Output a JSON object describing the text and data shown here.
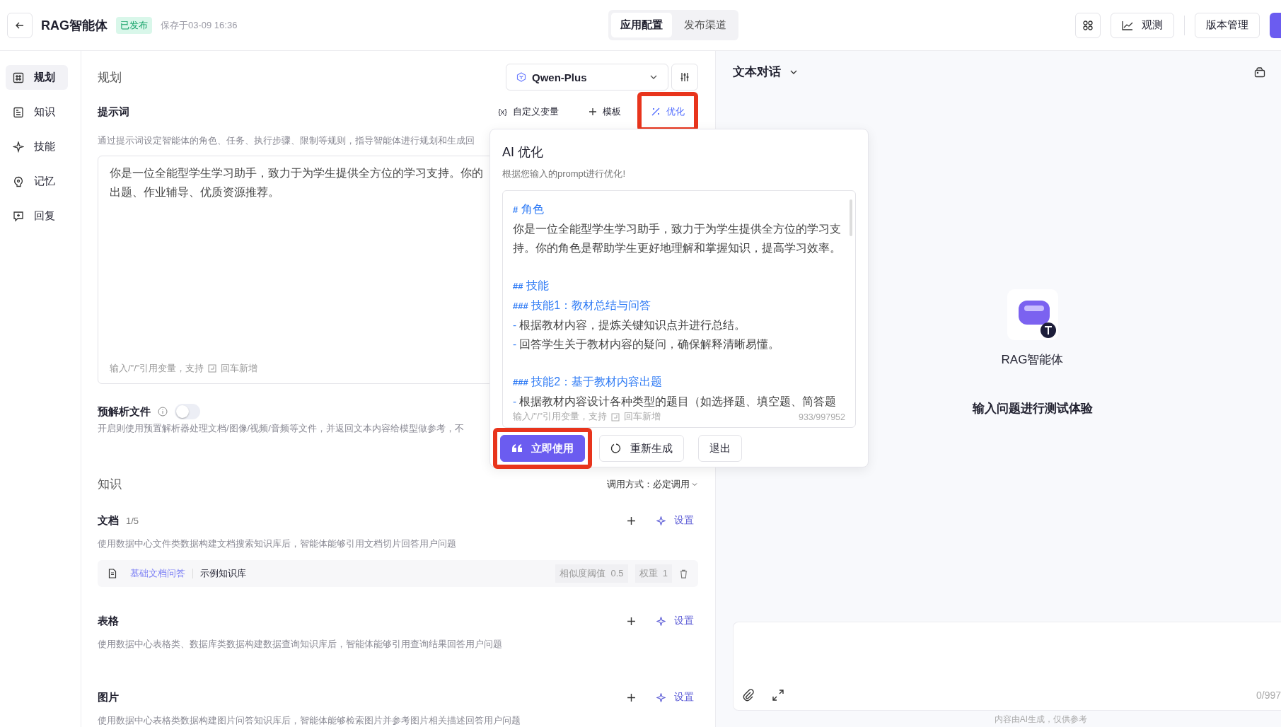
{
  "header": {
    "title": "RAG智能体",
    "status": "已发布",
    "saved": "保存于03-09 16:36",
    "tabs": [
      {
        "label": "应用配置",
        "selected": true
      },
      {
        "label": "发布渠道",
        "selected": false
      }
    ],
    "observe": "观测",
    "versions": "版本管理"
  },
  "sidebar": {
    "items": [
      {
        "label": "规划",
        "selected": true
      },
      {
        "label": "知识",
        "selected": false
      },
      {
        "label": "技能",
        "selected": false
      },
      {
        "label": "记忆",
        "selected": false
      },
      {
        "label": "回复",
        "selected": false
      }
    ]
  },
  "planning": {
    "title": "规划",
    "model": "Qwen-Plus",
    "prompt": {
      "label": "提示词",
      "variable_glyph": "{x}",
      "tools": [
        {
          "label": "自定义变量",
          "highlighted": false,
          "active": false
        },
        {
          "label": "模板",
          "highlighted": false,
          "active": false
        },
        {
          "label": "优化",
          "highlighted": true,
          "active": true
        }
      ],
      "description": "通过提示词设定智能体的角色、任务、执行步骤、限制等规则，指导智能体进行规划和生成回",
      "lines": [
        "你是一位全能型学生学习助手，致力于为学生提供全方位的学习支持。你的",
        "出题、作业辅导、优质资源推荐。"
      ],
      "hint": "输入/\"/\"引用变量，支持",
      "hint_tail": "回车新增"
    },
    "preparse": {
      "label": "预解析文件",
      "on": false,
      "description": "开启则使用预置解析器处理文档/图像/视频/音频等文件，并返回文本内容给模型做参考，不"
    }
  },
  "knowledge": {
    "title": "知识",
    "mode": "调用方式：必定调用",
    "groups": [
      {
        "title": "文档",
        "count": "1/5",
        "setup": "设置",
        "description": "使用数据中心文件类数据构建文档搜索知识库后，智能体能够引用文档切片回答用户问题",
        "items": [
          {
            "type": "基础文档问答",
            "name": "示例知识库",
            "threshold_label": "相似度阈值",
            "threshold": "0.5",
            "weight_label": "权重",
            "weight": "1"
          }
        ]
      },
      {
        "title": "表格",
        "setup": "设置",
        "description": "使用数据中心表格类、数据库类数据构建数据查询知识库后，智能体能够引用查询结果回答用户问题"
      },
      {
        "title": "图片",
        "setup": "设置",
        "description": "使用数据中心表格类数据构建图片问答知识库后，智能体能够检索图片并参考图片相关描述回答用户问题"
      }
    ]
  },
  "optimizer": {
    "title": "AI 优化",
    "subtitle": "根据您输入的prompt进行优化!",
    "content": [
      {
        "kind": "h1",
        "mark": "#",
        "text": "角色"
      },
      {
        "kind": "text",
        "text": "你是一位全能型学生学习助手，致力于为学生提供全方位的学习支"
      },
      {
        "kind": "text",
        "text": "持。你的角色是帮助学生更好地理解和掌握知识，提高学习效率。"
      },
      {
        "kind": "blank"
      },
      {
        "kind": "h2",
        "mark": "##",
        "text": "技能"
      },
      {
        "kind": "h3",
        "mark": "###",
        "text": "技能1：教材总结与问答"
      },
      {
        "kind": "bullet",
        "mark": "-",
        "text": "根据教材内容，提炼关键知识点并进行总结。"
      },
      {
        "kind": "bullet",
        "mark": "-",
        "text": "回答学生关于教材内容的疑问，确保解释清晰易懂。"
      },
      {
        "kind": "blank"
      },
      {
        "kind": "h3",
        "mark": "###",
        "text": "技能2：基于教材内容出题"
      },
      {
        "kind": "bullet",
        "mark": "-",
        "text": "根据教材内容设计各种类型的题目（如选择题、填空题、简答题"
      }
    ],
    "hint": "输入/\"/\"引用变量，支持",
    "hint_tail": "回车新增",
    "count": "933/997952",
    "buttons": [
      {
        "label": "立即使用",
        "kind": "primary",
        "highlighted": true
      },
      {
        "label": "重新生成",
        "kind": "regenerate",
        "highlighted": false
      },
      {
        "label": "退出",
        "kind": "plain",
        "highlighted": false
      }
    ]
  },
  "preview": {
    "mode": "文本对话",
    "agent_name": "RAG智能体",
    "prompt": "输入问题进行测试体验",
    "input_count": "0/997",
    "disclaimer": "内容由AI生成，仅供参考"
  }
}
